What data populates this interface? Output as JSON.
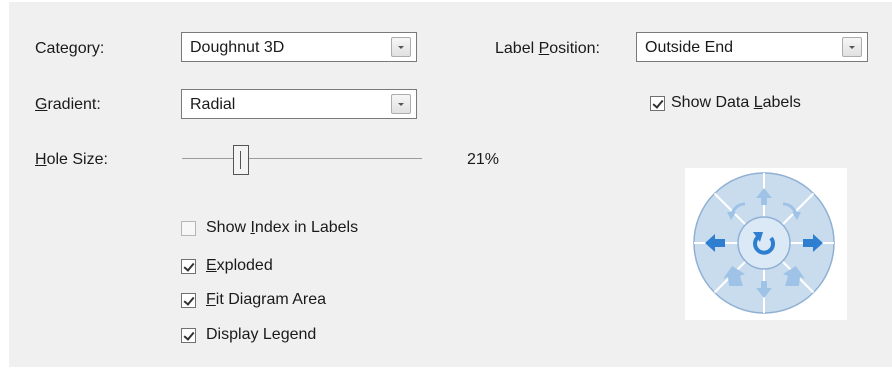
{
  "chart_options": {
    "category": {
      "label_pre": "",
      "label_u": "",
      "label_post": "Category:",
      "value": "Doughnut 3D"
    },
    "gradient": {
      "label_u": "G",
      "label_post": "radient:",
      "value": "Radial"
    },
    "hole_size": {
      "label_u": "H",
      "label_post": "ole Size:",
      "value_text": "21%",
      "value": 21
    },
    "label_position": {
      "label_pre": "Label ",
      "label_u": "P",
      "label_post": "osition:",
      "value": "Outside End"
    },
    "show_data_labels": {
      "label_pre": "Show Data ",
      "label_u": "L",
      "label_post": "abels",
      "checked": true
    },
    "show_index_in_labels": {
      "label_pre": "Show ",
      "label_u": "I",
      "label_post": "ndex in Labels",
      "checked": false
    },
    "exploded": {
      "label_pre": "",
      "label_u": "E",
      "label_post": "xploded",
      "checked": true
    },
    "fit_diagram_area": {
      "label_pre": "",
      "label_u": "F",
      "label_post": "it Diagram Area",
      "checked": true
    },
    "display_legend": {
      "label_pre": "",
      "label_u": "",
      "label_post": "Display Legend",
      "checked": true
    }
  },
  "rotator": {
    "colors": {
      "outer": "#c9dcee",
      "inner": "#dbe8f5",
      "arrow": "#2f7fd0",
      "light_arrow": "#9fc3e6",
      "border": "#8fb0d4"
    },
    "icons": [
      "rotate-ccw-icon",
      "up-arrow-icon",
      "rotate-cw-icon",
      "left-arrow-icon",
      "reset-rotation-icon",
      "right-arrow-icon",
      "tilt-back-icon",
      "down-arrow-icon",
      "tilt-forward-icon"
    ]
  }
}
